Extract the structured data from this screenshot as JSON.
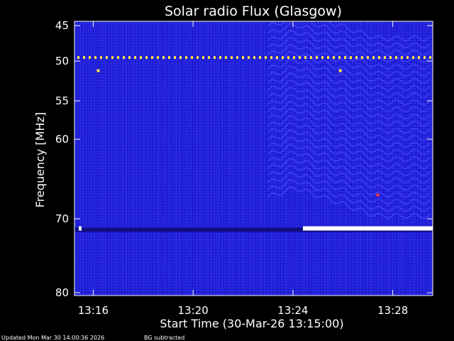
{
  "chart_data": {
    "type": "heatmap",
    "title": "Solar radio Flux (Glasgow)",
    "xlabel": "Start Time (30-Mar-26 13:15:00)",
    "ylabel": "Frequency [MHz]",
    "x_ticks": [
      "13:16",
      "13:20",
      "13:24",
      "13:28"
    ],
    "x_tick_minutes": [
      1,
      5,
      9,
      13
    ],
    "xlim_minutes": [
      0.25,
      14.6
    ],
    "y_ticks": [
      "45",
      "50",
      "55",
      "60",
      "70",
      "80"
    ],
    "y_tick_values": [
      45,
      50,
      55,
      60,
      70,
      80
    ],
    "ylim": [
      45,
      80
    ],
    "y_scale": "non-linear",
    "y_reversed": true,
    "grid": false,
    "colors": {
      "background": "#000000",
      "plot_base": "#1a18c8",
      "texture": "#3a3aff",
      "dark_band": "#0c0a70",
      "rfi_line": "#ffe14a",
      "saturated": "#ffffff",
      "burst": "#ff3a3a"
    },
    "features": {
      "interference_line_mhz": 49.5,
      "wave_pattern_start_minute": 8.0,
      "saturated_bar": {
        "start_minute": 9.4,
        "end_minute": 14.6,
        "frequency_mhz": 71.3
      },
      "dark_band_mhz": 71.5,
      "point_artifacts": [
        {
          "minute": 1.2,
          "frequency_mhz": 51.2
        },
        {
          "minute": 10.9,
          "frequency_mhz": 51.2
        },
        {
          "minute": 12.4,
          "frequency_mhz": 67.0
        }
      ]
    }
  },
  "footer": {
    "updated": "Updated Mon Mar 30 14:00:36 2026",
    "note": "BG subtracted"
  }
}
